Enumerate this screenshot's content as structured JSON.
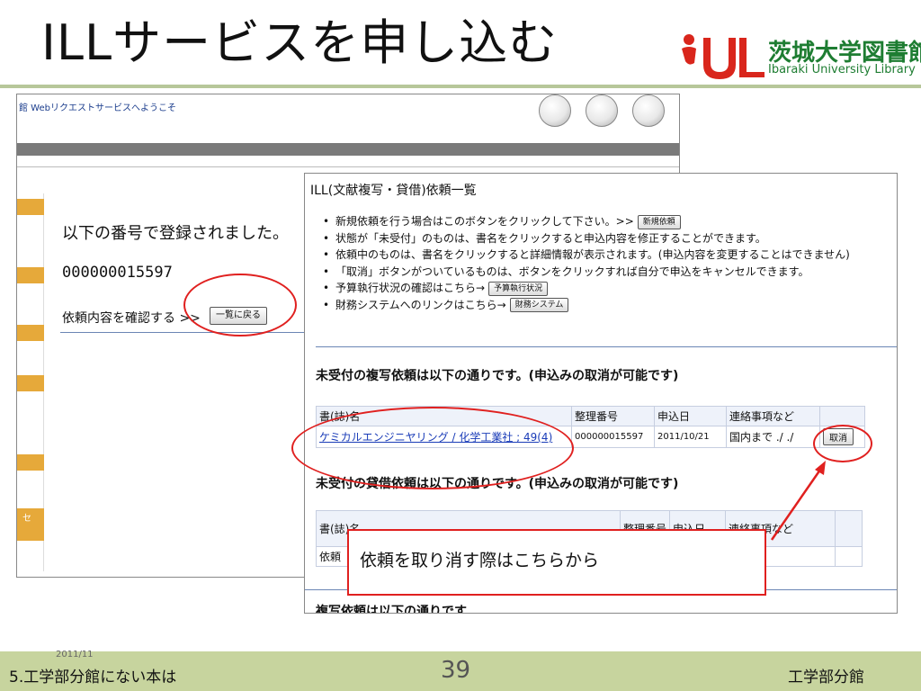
{
  "slide": {
    "title": "ILLサービスを申し込む",
    "logo": {
      "name_jp": "茨城大学図書館",
      "name_en": "Ibaraki University Library"
    }
  },
  "background_window": {
    "header_text": "館 Webリクエストサービスへようこそ",
    "side_tab_text": "セ",
    "registered_label": "以下の番号で登録されました。",
    "registration_number": "000000015597",
    "confirm_text": "依頼内容を確認する >>",
    "back_button": "一覧に戻る"
  },
  "ill_window": {
    "title": "ILL(文献複写・貸借)依頼一覧",
    "bullets": [
      {
        "text": "新規依頼を行う場合はこのボタンをクリックして下さい。>>",
        "button": "新規依頼"
      },
      {
        "text": "状態が「未受付」のものは、書名をクリックすると申込内容を修正することができます。"
      },
      {
        "text": "依頼中のものは、書名をクリックすると詳細情報が表示されます。(申込内容を変更することはできません)"
      },
      {
        "text": "「取消」ボタンがついているものは、ボタンをクリックすれば自分で申込をキャンセルできます。"
      },
      {
        "text": "予算執行状況の確認はこちら→",
        "button": "予算執行状況"
      },
      {
        "text": "財務システムへのリンクはこちら→",
        "button": "財務システム"
      }
    ],
    "copy_section": {
      "heading": "未受付の複写依頼は以下の通りです。(申込みの取消が可能です)",
      "columns": [
        "書(誌)名",
        "整理番号",
        "申込日",
        "連絡事項など",
        ""
      ],
      "rows": [
        {
          "title": "ケミカルエンジニヤリング / 化学工業社 ; 49(4)",
          "number": "000000015597",
          "date": "2011/10/21",
          "note": "国内まで ./ ./",
          "cancel": "取消"
        }
      ]
    },
    "loan_section": {
      "heading": "未受付の貸借依頼は以下の通りです。(申込みの取消が可能です)",
      "columns": [
        "書(誌)名",
        "整理番号",
        "申込日",
        "連絡事項など",
        ""
      ],
      "row_partial": "依頼"
    },
    "bottom_heading": "複写依頼は以下の通りです"
  },
  "callout": {
    "text": "依頼を取り消す際はこちらから"
  },
  "footer": {
    "date": "2011/11",
    "left": "5.工学部分館にない本は",
    "page": "39",
    "right": "工学部分館"
  },
  "colors": {
    "annotation_red": "#e0201f",
    "footer_green": "#c7d49e",
    "logo_green": "#1e7d32",
    "logo_red": "#d9261c",
    "link_blue": "#1a3cb8",
    "tab_orange": "#e6a93a"
  }
}
